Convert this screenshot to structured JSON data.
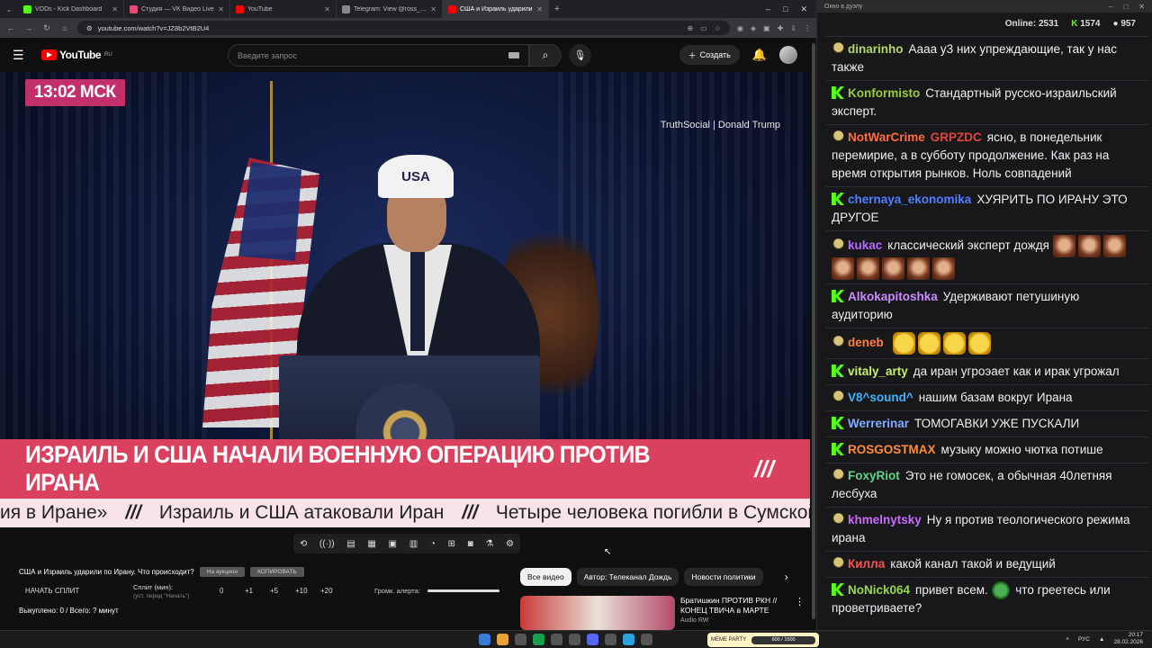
{
  "tabs": [
    {
      "label": "VODs - Kick Dashboard",
      "color": "#53fc18",
      "active": false
    },
    {
      "label": "Студия — VK Видео Live",
      "color": "#e64a77",
      "active": false
    },
    {
      "label": "YouTube",
      "color": "#ff0000",
      "active": false
    },
    {
      "label": "Telegram: View @ross_name",
      "color": "#888888",
      "active": false
    },
    {
      "label": "США и Израиль ударили",
      "color": "#ff0000",
      "active": true
    }
  ],
  "address": {
    "url": "youtube.com/watch?v=JZ8b2VtB2U4"
  },
  "youtube": {
    "logo": "YouTube",
    "region": "RU",
    "search_placeholder": "Введите запрос",
    "create_label": "Создать"
  },
  "video": {
    "clock": "13:02 МСК",
    "source": "TruthSocial | Donald Trump",
    "cap_text": "USA",
    "headline": "ИЗРАИЛЬ И США НАЧАЛИ ВОЕННУЮ ОПЕРАЦИЮ ПРОТИВ ИРАНА",
    "headline_mark": "///",
    "ticker": [
      "ия в Иране»",
      "///",
      "Израиль и США атаковали Иран",
      "///",
      "Четыре человека погибли в Сумской о"
    ]
  },
  "panel": {
    "title": "США и Израиль ударили по Ирану. Что происходит?",
    "btn_auction": "На аукцион",
    "btn_copy": "КОПИРОВАТЬ",
    "start_split": "НАЧАТЬ СПЛИТ",
    "split_label": "Сплит (мин):",
    "split_sub": "(уст. перед \"Начать\")",
    "split_values": [
      "0",
      "+1",
      "+5",
      "+10",
      "+20"
    ],
    "alert_label": "Громк. алерта:",
    "bought": "Выкуплено: 0 / Всего: ? минут"
  },
  "chips": [
    "Все видео",
    "Автор: Телеканал Дождь",
    "Новости политики"
  ],
  "recommendation": {
    "title_line1": "Братишкин ПРОТИВ РКН //",
    "title_line2": "КОНЕЦ ТВИЧА в МАРТЕ",
    "channel": "Audio RW"
  },
  "chat_window": {
    "title": "Окно в дуэлу"
  },
  "chat_stats": {
    "online_label": "Online:",
    "online": "2531",
    "kick": "1574",
    "other": "957"
  },
  "messages": [
    {
      "badge": "p",
      "user": "dinarinho",
      "color": "#b7d46b",
      "text": "Аааа у3 них упреждающие, так у нас также"
    },
    {
      "badge": "k",
      "user": "Konformisto",
      "color": "#9acd32",
      "text": "Стандартный русско-израильский эксперт."
    },
    {
      "badge": "p",
      "user": "NotWarCrime",
      "color": "#ff6b3d",
      "user2": "GRPZDC",
      "color2": "#e0453a",
      "text": "ясно, в понедельник перемирие, а в субботу продолжение. Как раз на время открытия рынков. Ноль совпадений"
    },
    {
      "badge": "k",
      "user": "chernaya_ekonomika",
      "color": "#4f7fff",
      "text": "ХУЯРИТЬ ПО ИРАНУ ЭТО ДРУГОЕ"
    },
    {
      "badge": "p",
      "user": "kukac",
      "color": "#b36bff",
      "text": "классический эксперт дождя",
      "emotes": 8,
      "emote_type": "face"
    },
    {
      "badge": "k",
      "user": "Alkokapitoshka",
      "color": "#c88cff",
      "text": "Удерживают петушиную аудиторию"
    },
    {
      "badge": "p",
      "user": "deneb",
      "color": "#ff7f3f",
      "text": "",
      "emotes": 4,
      "emote_type": "laugh"
    },
    {
      "badge": "k",
      "user": "vitaly_arty",
      "color": "#c7f06a",
      "text": "да иран угроэает как и ирак угрожал"
    },
    {
      "badge": "p",
      "user": "V8^sound^",
      "color": "#3fb4ff",
      "text": "нашим базам вокруг Ирана"
    },
    {
      "badge": "k",
      "user": "Werrerinar",
      "color": "#7faaff",
      "text": "ТОМОГАВКИ УЖЕ ПУСКАЛИ"
    },
    {
      "badge": "k",
      "user": "ROSGOSTMAX",
      "color": "#ff8c3a",
      "text": "музыку можно чютка потише"
    },
    {
      "badge": "p",
      "user": "FoxyRiot",
      "color": "#5fd48a",
      "text": "Это не гомосек,  а обычная 40летняя лесбуха"
    },
    {
      "badge": "p",
      "user": "khmelnytsky",
      "color": "#c86bff",
      "text": "Ну я против теологического режима ирана"
    },
    {
      "badge": "p",
      "user": "Килла",
      "color": "#ff4f4f",
      "text": "какой канал такой и ведущий"
    },
    {
      "badge": "k",
      "user": "NoNick064",
      "color": "#9ad64a",
      "text": "привет всем.",
      "emotes": 1,
      "emote_type": "frog",
      "text2": "что греетесь или проветриваете?"
    }
  ],
  "taskbar": {
    "meme_label": "MEME PARTY",
    "meme_progress": "600 / 1500",
    "lang": "РУС",
    "time": "20:17",
    "date": "28.02.2026"
  }
}
